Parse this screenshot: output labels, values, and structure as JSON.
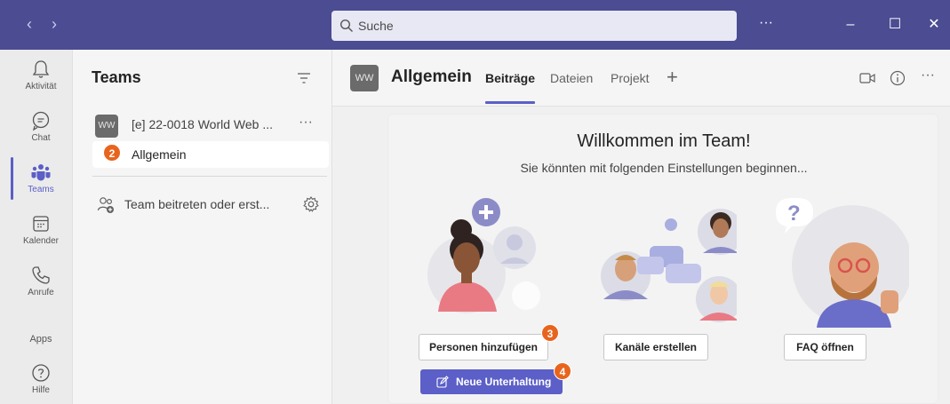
{
  "titlebar": {
    "back": "‹",
    "forward": "›",
    "search_placeholder": "Suche",
    "more": "···",
    "minimize": "–",
    "maximize": "☐",
    "close": "✕"
  },
  "rail": {
    "items": [
      {
        "label": "Aktivität",
        "icon": "bell-icon"
      },
      {
        "label": "Chat",
        "icon": "chat-icon"
      },
      {
        "label": "Teams",
        "icon": "teams-icon"
      },
      {
        "label": "Kalender",
        "icon": "calendar-icon"
      },
      {
        "label": "Anrufe",
        "icon": "phone-icon"
      },
      {
        "label": "Apps",
        "icon": "apps-icon"
      },
      {
        "label": "Hilfe",
        "icon": "help-icon"
      }
    ],
    "active": "Teams",
    "accent": "#5b5fc7"
  },
  "teams_panel": {
    "title": "Teams",
    "team": {
      "avatar": "WW",
      "name": "[e] 22-0018 World Web ...",
      "more": "···"
    },
    "channel": {
      "name": "Allgemein"
    },
    "join": "Team beitreten oder erst..."
  },
  "channel_header": {
    "avatar": "WW",
    "title": "Allgemein",
    "tabs": [
      "Beiträge",
      "Dateien",
      "Projekt"
    ],
    "active_tab": "Beiträge",
    "add_tab": "+",
    "more": "···"
  },
  "welcome": {
    "title": "Willkommen im Team!",
    "subtitle": "Sie könnten mit folgenden Einstellungen beginnen...",
    "buttons": {
      "add_people": "Personen hinzufügen",
      "create_channels": "Kanäle erstellen",
      "open_faq": "FAQ öffnen",
      "new_conversation": "Neue Unterhaltung"
    }
  },
  "badges": {
    "b2": "2",
    "b3": "3",
    "b4": "4"
  },
  "colors": {
    "titlebar": "#4b4c92",
    "accent": "#5b5fc7",
    "badge": "#e8641d"
  }
}
